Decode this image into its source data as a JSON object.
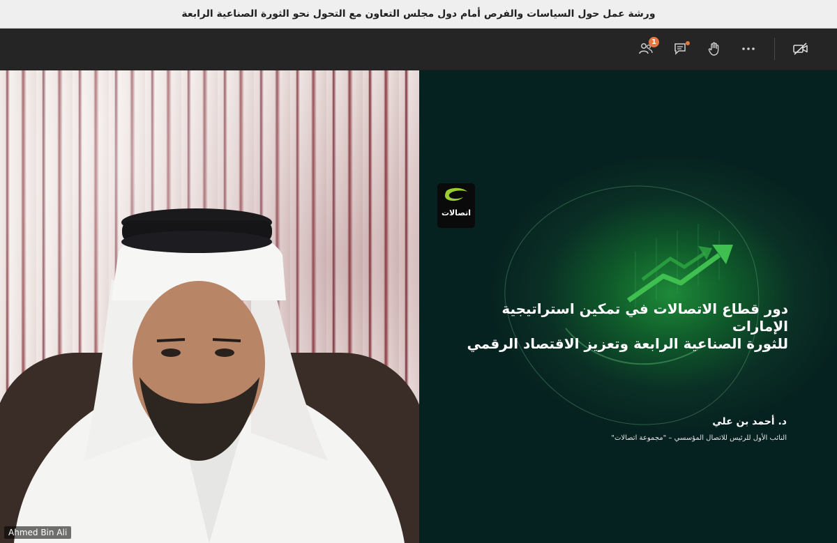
{
  "window": {
    "title": "ورشة عمل حول السياسات والفرص أمام دول مجلس التعاون مع التحول نحو الثورة الصناعية الرابعة"
  },
  "toolbar": {
    "participants_badge": "1",
    "icons": [
      "participants-icon",
      "chat-icon",
      "raise-hand-icon",
      "more-icon",
      "camera-off-icon"
    ],
    "accent": "#e5773f"
  },
  "video": {
    "participant_name": "Ahmed Bin Ali"
  },
  "slide": {
    "logo_text": "اتصالات",
    "title_line1": "دور  قطاع الاتصالات في تمكين استراتيجية الإمارات",
    "title_line2": "للثورة الصناعية  الرابعة وتعزيز الاقتصاد الرقمي",
    "presenter_name": "د. أحمد بن علي",
    "presenter_role": "النائب الأول للرئيس للاتصال المؤسسي – \"مجموعة اتصالات\"",
    "brand_color": "#9acd32"
  }
}
